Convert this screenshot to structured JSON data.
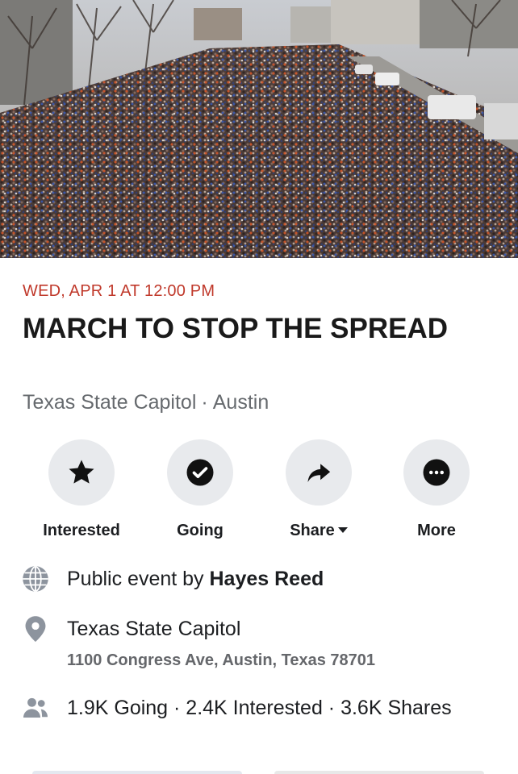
{
  "event": {
    "date": "WED, APR 1 AT 12:00 PM",
    "title": "MARCH TO STOP THE SPREAD",
    "venue": "Texas State Capitol",
    "city": "Austin",
    "separator": "·"
  },
  "actions": [
    {
      "label": "Interested",
      "icon": "star-icon"
    },
    {
      "label": "Going",
      "icon": "check-circle-icon"
    },
    {
      "label": "Share",
      "icon": "share-arrow-icon"
    },
    {
      "label": "More",
      "icon": "more-dots-icon"
    }
  ],
  "info": {
    "public_prefix": "Public event by ",
    "host": "Hayes Reed",
    "location_name": "Texas State Capitol",
    "address": "1100 Congress Ave, Austin, Texas 78701",
    "stats": "1.9K Going · 2.4K Interested · 3.6K Shares"
  },
  "colors": {
    "date_accent": "#c0392b",
    "action_circle": "#e8eaed",
    "icon_gray": "#8d949e"
  }
}
